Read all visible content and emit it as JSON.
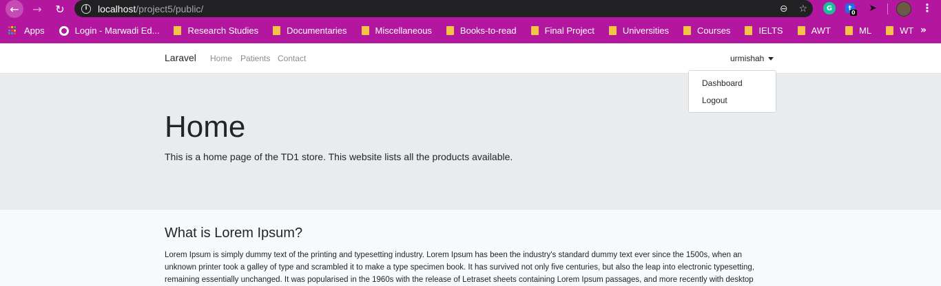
{
  "browser": {
    "url_host": "localhost",
    "url_path": "/project5/public/",
    "extension_badge": "0"
  },
  "bookmarks": [
    {
      "label": "Apps",
      "icon": "apps-icon"
    },
    {
      "label": "Login - Marwadi Ed...",
      "icon": "globe-icon"
    },
    {
      "label": "Research Studies",
      "icon": "folder-icon"
    },
    {
      "label": "Documentaries",
      "icon": "folder-icon"
    },
    {
      "label": "Miscellaneous",
      "icon": "folder-icon"
    },
    {
      "label": "Books-to-read",
      "icon": "folder-icon"
    },
    {
      "label": "Final Project",
      "icon": "folder-icon"
    },
    {
      "label": "Universities",
      "icon": "folder-icon"
    },
    {
      "label": "Courses",
      "icon": "folder-icon"
    },
    {
      "label": "IELTS",
      "icon": "folder-icon"
    },
    {
      "label": "AWT",
      "icon": "folder-icon"
    },
    {
      "label": "ML",
      "icon": "folder-icon"
    },
    {
      "label": "WT",
      "icon": "folder-icon"
    }
  ],
  "navbar": {
    "brand": "Laravel",
    "links": [
      "Home",
      "Patients",
      "Contact"
    ],
    "user": "urmishah"
  },
  "dropdown": {
    "items": [
      "Dashboard",
      "Logout"
    ]
  },
  "jumbotron": {
    "title": "Home",
    "text": "This is a home page of the TD1 store. This website lists all the products available."
  },
  "content": {
    "heading": "What is Lorem Ipsum?",
    "paragraph": "Lorem Ipsum is simply dummy text of the printing and typesetting industry. Lorem Ipsum has been the industry's standard dummy text ever since the 1500s, when an unknown printer took a galley of type and scrambled it to make a type specimen book. It has survived not only five centuries, but also the leap into electronic typesetting, remaining essentially unchanged. It was popularised in the 1960s with the release of Letraset sheets containing Lorem Ipsum passages, and more recently with desktop"
  },
  "colors": {
    "browser_chrome": "#b3179f",
    "omnibox": "#212124",
    "jumbotron": "#e9ecef",
    "page_bg": "#f8f9fa"
  }
}
